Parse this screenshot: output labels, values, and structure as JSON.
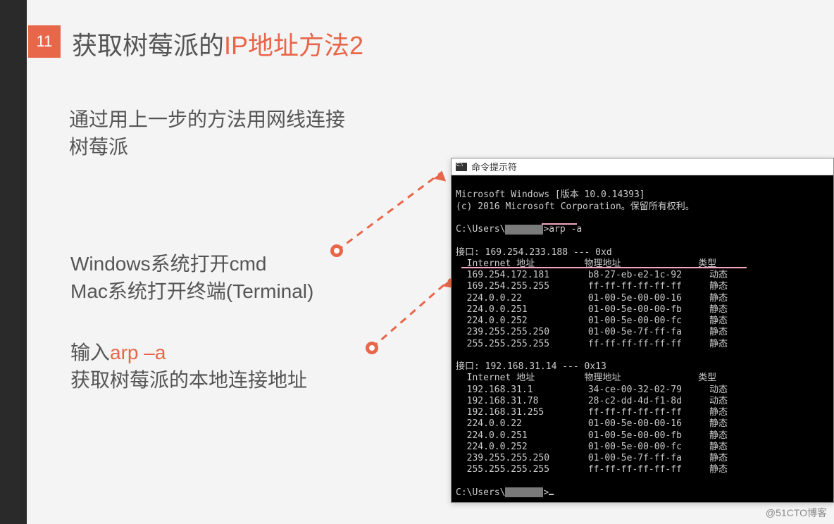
{
  "slide_number": "11",
  "title_black": "获取树莓派的",
  "title_accent": "IP地址方法2",
  "para1_line1": "通过用上一步的方法用网线连接",
  "para1_line2": "树莓派",
  "para2_line1": "Windows系统打开cmd",
  "para2_line2": "Mac系统打开终端(Terminal)",
  "para3_prefix": "输入",
  "para3_accent": "arp –a",
  "para3_line2": "获取树莓派的本地连接地址",
  "cmd": {
    "title": "命令提示符",
    "line1": "Microsoft Windows [版本 10.0.14393]",
    "line2": "(c) 2016 Microsoft Corporation。保留所有权利。",
    "prompt_prefix": "C:\\Users\\",
    "cmd_after": ">arp -a",
    "iface1_header": "接口: 169.254.233.188 --- 0xd",
    "col_header": "  Internet 地址         物理地址              类型",
    "iface1_rows": [
      "  169.254.172.181       b8-27-eb-e2-1c-92     动态",
      "  169.254.255.255       ff-ff-ff-ff-ff-ff     静态",
      "  224.0.0.22            01-00-5e-00-00-16     静态",
      "  224.0.0.251           01-00-5e-00-00-fb     静态",
      "  224.0.0.252           01-00-5e-00-00-fc     静态",
      "  239.255.255.250       01-00-5e-7f-ff-fa     静态",
      "  255.255.255.255       ff-ff-ff-ff-ff-ff     静态"
    ],
    "iface2_header": "接口: 192.168.31.14 --- 0x13",
    "iface2_rows": [
      "  192.168.31.1          34-ce-00-32-02-79     动态",
      "  192.168.31.78         28-c2-dd-4d-f1-8d     动态",
      "  192.168.31.255        ff-ff-ff-ff-ff-ff     静态",
      "  224.0.0.22            01-00-5e-00-00-16     静态",
      "  224.0.0.251           01-00-5e-00-00-fb     静态",
      "  224.0.0.252           01-00-5e-00-00-fc     静态",
      "  239.255.255.250       01-00-5e-7f-ff-fa     静态",
      "  255.255.255.255       ff-ff-ff-ff-ff-ff     静态"
    ],
    "prompt2_suffix": ">"
  },
  "watermark": "@51CTO博客"
}
